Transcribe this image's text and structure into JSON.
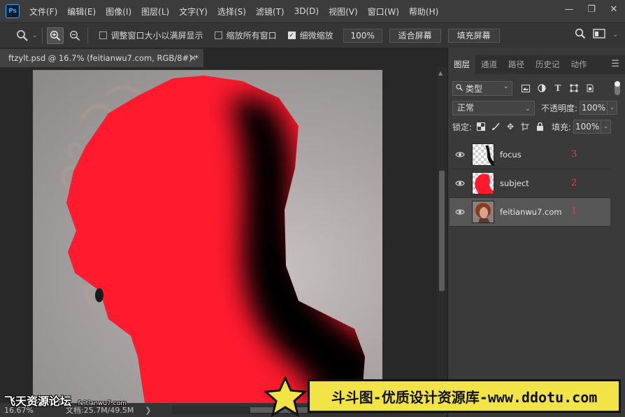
{
  "app": {
    "logo": "Ps",
    "menu": [
      "文件(F)",
      "编辑(E)",
      "图像(I)",
      "图层(L)",
      "文字(Y)",
      "选择(S)",
      "滤镜(T)",
      "3D(D)",
      "视图(V)",
      "窗口(W)",
      "帮助(H)"
    ],
    "window_controls": {
      "minimize": "—",
      "restore": "❐",
      "close": "✕"
    }
  },
  "options": {
    "resize_windows_label": "调整窗口大小以满屏显示",
    "resize_windows_checked": false,
    "zoom_all_label": "缩放所有窗口",
    "zoom_all_checked": false,
    "scrubby_zoom_label": "细微缩放",
    "scrubby_zoom_checked": true,
    "zoom_value": "100%",
    "fit_screen_label": "适合屏幕",
    "fill_screen_label": "填充屏幕"
  },
  "document": {
    "tab_title": "ftzylt.psd @ 16.7% (feitianwu7.com, RGB/8#) *",
    "close_glyph": "✕"
  },
  "status": {
    "zoom": "16.67%",
    "doc_info": "文档:25.7M/49.5M",
    "arrow": "❯"
  },
  "panel": {
    "tabs": [
      "图层",
      "通道",
      "路径",
      "历史记",
      "动作"
    ],
    "active_tab": "图层",
    "filter_kind": "类型",
    "blend_mode": "正常",
    "opacity_label": "不透明度:",
    "opacity_value": "100%",
    "lock_label": "锁定:",
    "fill_label": "填充:",
    "fill_value": "100%",
    "layers": [
      {
        "name": "focus",
        "number": "3",
        "visible": true,
        "selected": false
      },
      {
        "name": "subject",
        "number": "2",
        "visible": true,
        "selected": false
      },
      {
        "name": "feitianwu7.com",
        "number": "1",
        "visible": true,
        "selected": true
      }
    ]
  },
  "watermarks": {
    "left_main": "飞天资源论坛",
    "left_small": "feitianwu7.com",
    "right_banner": "斗斗图-优质设计资源库-www.ddotu.com"
  },
  "colors": {
    "subject_red": "#ff1a2e",
    "accent_blue": "#31a8ff",
    "banner_yellow": "#f2e447"
  }
}
